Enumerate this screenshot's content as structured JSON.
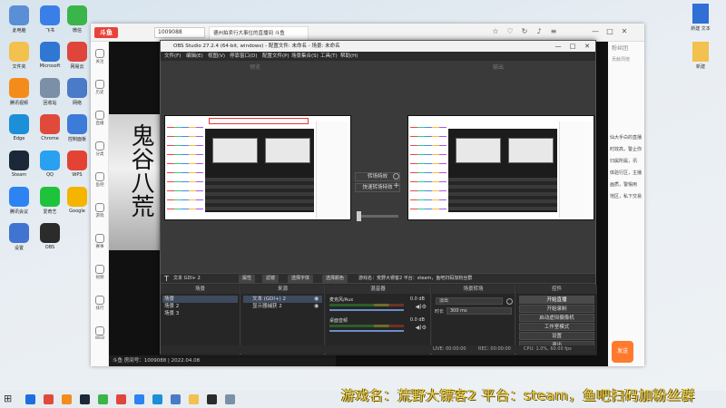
{
  "desktop_icons": [
    {
      "label": "此电脑",
      "color": "#5a8fd6"
    },
    {
      "label": "飞书",
      "color": "#3a7ee8"
    },
    {
      "label": "微信",
      "color": "#39b54a"
    },
    {
      "label": "文件夹",
      "color": "#f2c14e"
    },
    {
      "label": "Microsoft",
      "color": "#2f77d3"
    },
    {
      "label": "网易云",
      "color": "#e0453b"
    },
    {
      "label": "腾讯视频",
      "color": "#f48c1c"
    },
    {
      "label": "回收站",
      "color": "#7b8fa6"
    },
    {
      "label": "网络",
      "color": "#4a7ac8"
    },
    {
      "label": "Edge",
      "color": "#1b8fd8"
    },
    {
      "label": "Chrome",
      "color": "#e04a3a"
    },
    {
      "label": "控制面板",
      "color": "#3d7bd9"
    },
    {
      "label": "Steam",
      "color": "#1b2838"
    },
    {
      "label": "QQ",
      "color": "#2aa0f0"
    },
    {
      "label": "WPS",
      "color": "#e34334"
    },
    {
      "label": "腾讯会议",
      "color": "#2d83f2"
    },
    {
      "label": "爱奇艺",
      "color": "#1fc33b"
    },
    {
      "label": "Google",
      "color": "#f4b400"
    },
    {
      "label": "设置",
      "color": "#4173d1"
    },
    {
      "label": "OBS",
      "color": "#2b2b2b"
    }
  ],
  "right_icons": [
    {
      "label": "新建 文本",
      "color": "#2f6fd6"
    },
    {
      "label": "新建",
      "color": "#f2c14e"
    }
  ],
  "browser": {
    "logo": "斗鱼",
    "search_value": "1009088",
    "tab_title": "德州拍卖行大事位的直播间 斗鱼",
    "window_controls": [
      "—",
      "□",
      "✕"
    ],
    "sidebar": [
      "关注",
      "历史",
      "直播",
      "分类",
      "鱼吧",
      "游戏",
      "赛事",
      "视频",
      "排行",
      "WEB"
    ],
    "video_art_text": "鬼谷八荒",
    "status_line": "斗鱼 房间号：1009088 | 2022.04.08",
    "right_tab": "粉丝团",
    "right_sub": "贡献周榜",
    "right_text": [
      "仙大手白的直播",
      "时效高，警止你",
      "归属所属，讯",
      "体验行区，主播",
      "画质，警惕用",
      "地区，私下交易"
    ],
    "right_button": "发送"
  },
  "obs": {
    "title": "OBS Studio 27.2.4 (64-bit, windows) - 配置文件: 未命名 - 场景: 未命名",
    "menu": [
      "文件(F)",
      "编辑(E)",
      "视图(V)",
      "停靠窗口(D)",
      "配置文件(P)",
      "场景集合(S)",
      "工具(T)",
      "帮助(H)"
    ],
    "preview_label": "预览",
    "program_label": "输出",
    "transition_buttons": [
      "转场特效",
      "快速转场特效"
    ],
    "source_bar": {
      "source": "文本  GDI+ 2",
      "props": "属性",
      "filter": "滤镜",
      "font": "选择字体",
      "color": "选择颜色",
      "text": "游戏名：荒野大镖客2  平台：steam，鱼吧扫码加粉丝群"
    },
    "docks": {
      "scenes": {
        "title": "场景",
        "items": [
          "场景",
          "场景 2",
          "场景 3"
        ]
      },
      "sources": {
        "title": "来源",
        "items": [
          "文本 (GDI+) 2",
          "显示器捕获 2"
        ]
      },
      "mixer": {
        "title": "混音器",
        "channels": [
          {
            "name": "麦克风/Aux",
            "db": "0.0 dB"
          },
          {
            "name": "桌面音频",
            "db": "0.0 dB"
          }
        ]
      },
      "transitions": {
        "title": "场景转场",
        "type": "淡出",
        "duration_label": "时长",
        "duration": "300 ms"
      },
      "controls": {
        "title": "控件",
        "buttons": [
          "开始直播",
          "开始录制",
          "启动虚拟摄像机",
          "工作室模式",
          "设置",
          "退出"
        ]
      }
    },
    "status": {
      "live": "LIVE: 00:00:00",
      "rec": "REC: 00:00:00",
      "cpu": "CPU: 1.0%, 60.00 fps"
    }
  },
  "overlay_text": "游戏名：荒野大镖客2  平台：steam，鱼吧扫码加粉丝群",
  "taskbar_icons": [
    "#1d6fe0",
    "#e04a3a",
    "#f48c1c",
    "#1b2838",
    "#39b54a",
    "#e0453b",
    "#2d83f2",
    "#1b8fd8",
    "#4a7ac8",
    "#f2c14e",
    "#2b2b2b",
    "#7b8fa6"
  ]
}
